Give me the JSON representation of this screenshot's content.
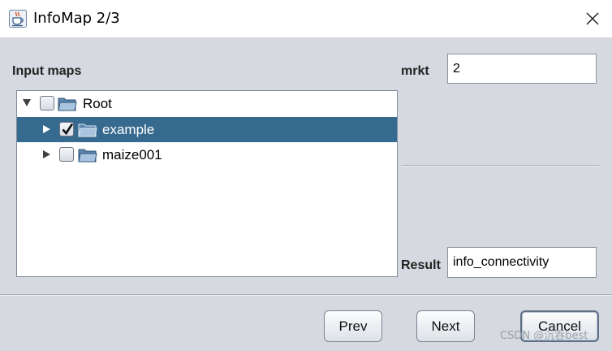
{
  "window": {
    "title": "InfoMap 2/3",
    "close_icon": "close-icon",
    "app_icon": "java-coffee-cup-icon"
  },
  "input_maps": {
    "label": "Input maps",
    "tree": [
      {
        "label": "Root",
        "checked": false,
        "expanded": true,
        "selected": false
      },
      {
        "label": "example",
        "checked": true,
        "expanded": false,
        "selected": true
      },
      {
        "label": "maize001",
        "checked": false,
        "expanded": false,
        "selected": false
      }
    ]
  },
  "params": {
    "mrkt_label": "mrkt",
    "mrkt_value": "2",
    "result_label": "Result",
    "result_value": "info_connectivity"
  },
  "buttons": {
    "prev": "Prev",
    "next": "Next",
    "cancel": "Cancel"
  },
  "watermark": "CSDN @沉吞best",
  "colors": {
    "selection": "#376a8f",
    "background": "#d6d9df"
  }
}
